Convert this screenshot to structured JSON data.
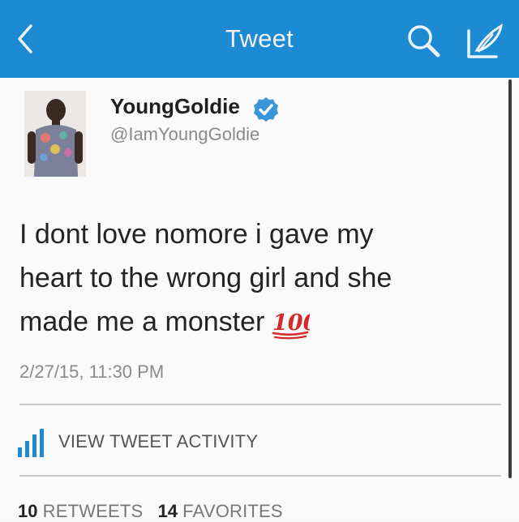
{
  "navbar": {
    "title": "Tweet",
    "back_icon": "chevron-left-icon",
    "search_icon": "search-icon",
    "compose_icon": "compose-icon",
    "bar_color": "#1d8ad4"
  },
  "tweet": {
    "display_name": "YoungGoldie",
    "verified": true,
    "handle": "@IamYoungGoldie",
    "text_lines": [
      "I dont love nomore  i gave my",
      "heart to the wrong girl and she",
      "made me a monster"
    ],
    "emoji": "100-emoji",
    "timestamp": "2/27/15, 11:30 PM"
  },
  "activity": {
    "label": "VIEW TWEET ACTIVITY",
    "icon": "bar-chart-icon"
  },
  "stats": {
    "retweets_count": "10",
    "retweets_label": "RETWEETS",
    "favorites_count": "14",
    "favorites_label": "FAVORITES"
  }
}
